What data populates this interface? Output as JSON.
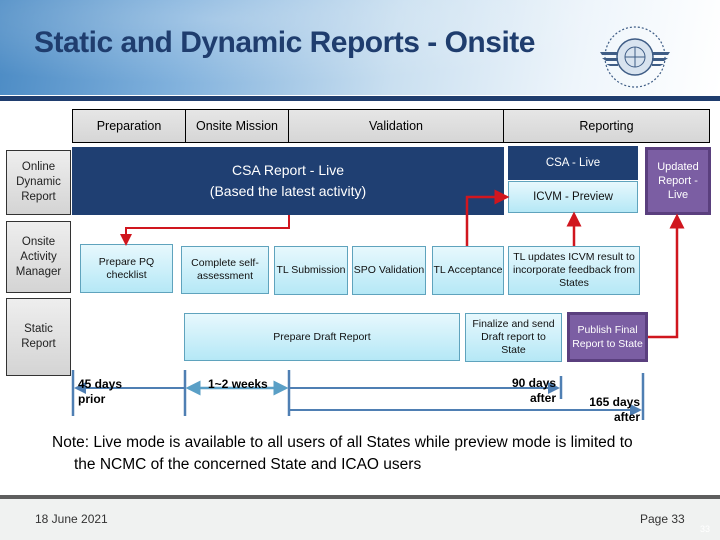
{
  "header": {
    "title": "Static and Dynamic Reports - Onsite",
    "logo_icon": "icao-logo-icon"
  },
  "phases": [
    {
      "label": "Preparation"
    },
    {
      "label": "Onsite Mission"
    },
    {
      "label": "Validation"
    },
    {
      "label": "Reporting"
    }
  ],
  "rows": [
    {
      "label": "Online Dynamic Report"
    },
    {
      "label": "Onsite Activity Manager"
    },
    {
      "label": "Static Report"
    }
  ],
  "dynamic": {
    "csa_report_line1": "CSA Report - Live",
    "csa_report_line2": "(Based the latest activity)",
    "csa_live": "CSA - Live",
    "icvm_preview": "ICVM - Preview",
    "updated_report": "Updated Report - Live"
  },
  "activities": [
    {
      "label": "Prepare PQ checklist"
    },
    {
      "label": "Complete self-assessment"
    },
    {
      "label": "TL Submission"
    },
    {
      "label": "SPO Validation"
    },
    {
      "label": "TL Acceptance"
    },
    {
      "label": "TL updates ICVM result to incorporate feedback from States"
    }
  ],
  "static_report": {
    "prepare_draft": "Prepare Draft Report",
    "finalize": "Finalize and send Draft report to State",
    "publish": "Publish Final Report to State"
  },
  "timeline": {
    "t1": "45 days prior",
    "t2": "1~2 weeks",
    "t3": "90 days after",
    "t4": "165 days after"
  },
  "note": {
    "line1": "Note: Live mode is available to all users of all States while preview mode is limited to",
    "line2": "the NCMC of the concerned State and ICAO users"
  },
  "footer": {
    "date": "18 June 2021",
    "page": "Page 33",
    "slide_number": "33"
  },
  "colors": {
    "navy": "#1f3f72",
    "light_blue": "#b5e8f6",
    "purple": "#7b5ea3",
    "arrow_red": "#d0161e",
    "timeline_blue": "#4f7fb3"
  }
}
